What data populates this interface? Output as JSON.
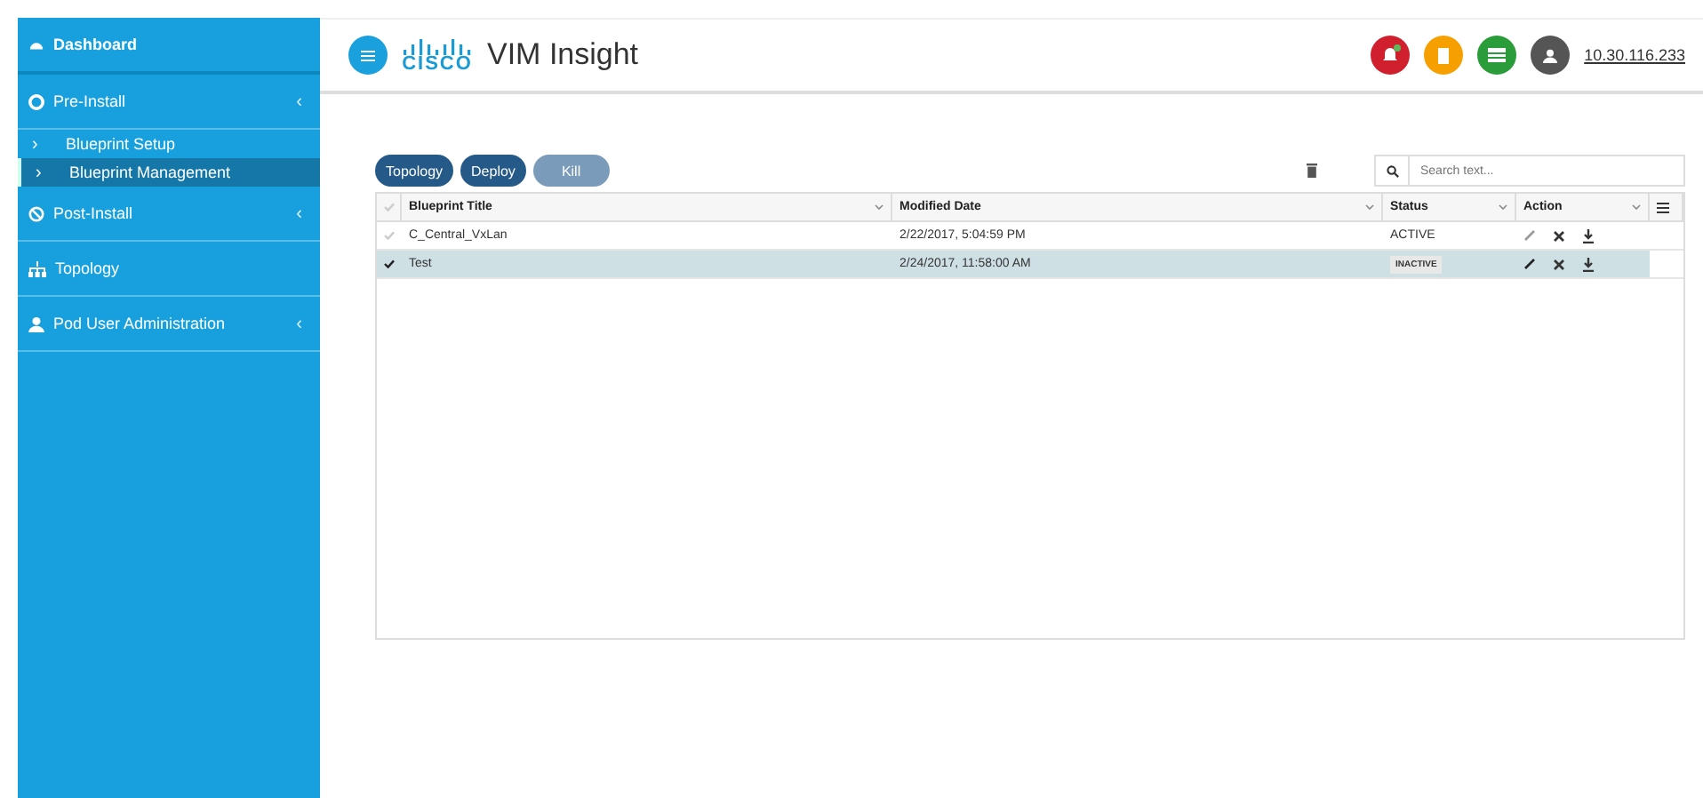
{
  "sidebar": {
    "items": [
      {
        "kind": "header",
        "label": "Dashboard"
      },
      {
        "kind": "section",
        "label": "Pre-Install",
        "chevron": "‹"
      },
      {
        "kind": "sub",
        "label": "Blueprint Setup",
        "chevron": "›",
        "selected": false
      },
      {
        "kind": "sub",
        "label": "Blueprint Management",
        "chevron": "›",
        "selected": true
      },
      {
        "kind": "section",
        "label": "Post-Install",
        "chevron": "‹"
      },
      {
        "kind": "section",
        "label": "Topology"
      },
      {
        "kind": "section",
        "label": "Pod User Administration",
        "chevron": "‹"
      }
    ]
  },
  "header": {
    "title": "VIM Insight",
    "logo_text": "CISCO",
    "user": "10.30.116.233"
  },
  "toolbar": {
    "buttons": [
      {
        "label": "Topology",
        "disabled": false
      },
      {
        "label": "Deploy",
        "disabled": false
      },
      {
        "label": "Kill",
        "disabled": true
      }
    ],
    "search": {
      "placeholder": "Search text..."
    }
  },
  "table": {
    "select_all": {
      "checked": false
    },
    "columns": [
      "Blueprint Title",
      "Modified Date",
      "Status",
      "Action"
    ],
    "rows": [
      {
        "title": "C_Central_VxLan",
        "date": "2/22/2017, 5:04:59 PM",
        "status": "ACTIVE",
        "kind": "plain",
        "selected": false
      },
      {
        "title": "Test",
        "date": "2/24/2017, 11:58:00 AM",
        "status": "INACTIVE",
        "kind": "badge",
        "selected": true
      }
    ]
  }
}
